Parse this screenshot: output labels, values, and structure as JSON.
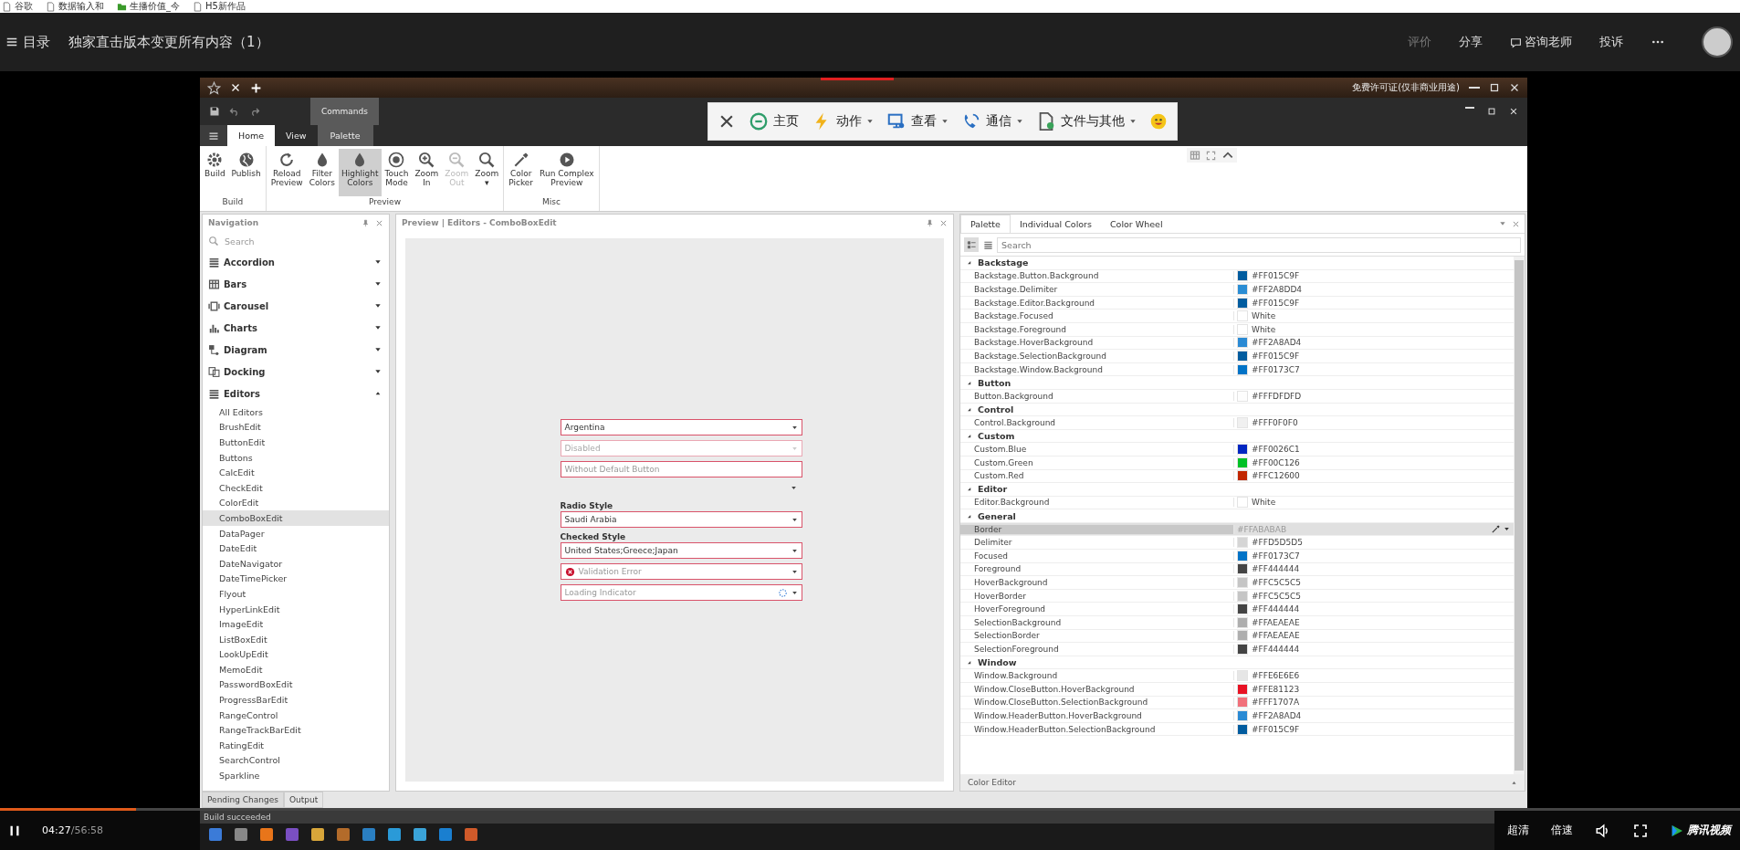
{
  "bookmarks": [
    {
      "label": "谷歌"
    },
    {
      "label": "数据输入和"
    },
    {
      "label": "生播价值_今"
    },
    {
      "label": "H5新作品"
    }
  ],
  "header": {
    "menu_label": "目录",
    "title": "独家直击版本变更所有内容（1）",
    "actions": [
      {
        "label": "评价",
        "disabled": true
      },
      {
        "label": "分享",
        "disabled": false
      },
      {
        "label": "咨询老师",
        "disabled": false
      },
      {
        "label": "投诉",
        "disabled": false
      }
    ]
  },
  "video": {
    "titlebar_text": "免费许可证(仅非商业用途)",
    "contextual_group": "Commands",
    "tabs": [
      {
        "label": "Home",
        "selected": true,
        "contextual": false
      },
      {
        "label": "View",
        "selected": false,
        "contextual": false
      },
      {
        "label": "Palette",
        "selected": false,
        "contextual": true
      }
    ],
    "overlay_toolbar": [
      {
        "kind": "close"
      },
      {
        "kind": "item",
        "label": "主页",
        "dropdown": false
      },
      {
        "kind": "item",
        "label": "动作",
        "dropdown": true
      },
      {
        "kind": "item",
        "label": "查看",
        "dropdown": true
      },
      {
        "kind": "item",
        "label": "通信",
        "dropdown": true
      },
      {
        "kind": "item",
        "label": "文件与其他",
        "dropdown": true
      },
      {
        "kind": "emoji"
      }
    ],
    "ribbon": [
      {
        "label": "Build",
        "buttons": [
          {
            "lines": [
              "Build"
            ],
            "pressed": false,
            "disabled": false
          },
          {
            "lines": [
              "Publish"
            ],
            "pressed": false,
            "disabled": false
          }
        ]
      },
      {
        "label": "Preview",
        "buttons": [
          {
            "lines": [
              "Reload",
              "Preview"
            ],
            "pressed": false,
            "disabled": false
          },
          {
            "lines": [
              "Filter",
              "Colors"
            ],
            "pressed": false,
            "disabled": false
          },
          {
            "lines": [
              "Highlight",
              "Colors"
            ],
            "pressed": true,
            "disabled": false
          },
          {
            "lines": [
              "Touch",
              "Mode"
            ],
            "pressed": false,
            "disabled": false
          },
          {
            "lines": [
              "Zoom",
              "In"
            ],
            "pressed": false,
            "disabled": false
          },
          {
            "lines": [
              "Zoom",
              "Out"
            ],
            "pressed": false,
            "disabled": true
          },
          {
            "lines": [
              "Zoom",
              "▾"
            ],
            "pressed": false,
            "disabled": false
          }
        ]
      },
      {
        "label": "Misc",
        "buttons": [
          {
            "lines": [
              "Color",
              "Picker"
            ],
            "pressed": false,
            "disabled": false
          },
          {
            "lines": [
              "Run Complex",
              "Preview"
            ],
            "pressed": false,
            "disabled": false
          }
        ]
      }
    ],
    "navigation": {
      "title": "Navigation",
      "search_placeholder": "Search",
      "groups": [
        {
          "label": "Accordion",
          "expanded": false
        },
        {
          "label": "Bars",
          "expanded": false
        },
        {
          "label": "Carousel",
          "expanded": false
        },
        {
          "label": "Charts",
          "expanded": false
        },
        {
          "label": "Diagram",
          "expanded": false
        },
        {
          "label": "Docking",
          "expanded": false
        },
        {
          "label": "Editors",
          "expanded": true,
          "children": [
            {
              "label": "All Editors",
              "selected": false
            },
            {
              "label": "BrushEdit",
              "selected": false
            },
            {
              "label": "ButtonEdit",
              "selected": false
            },
            {
              "label": "Buttons",
              "selected": false
            },
            {
              "label": "CalcEdit",
              "selected": false
            },
            {
              "label": "CheckEdit",
              "selected": false
            },
            {
              "label": "ColorEdit",
              "selected": false
            },
            {
              "label": "ComboBoxEdit",
              "selected": true
            },
            {
              "label": "DataPager",
              "selected": false
            },
            {
              "label": "DateEdit",
              "selected": false
            },
            {
              "label": "DateNavigator",
              "selected": false
            },
            {
              "label": "DateTimePicker",
              "selected": false
            },
            {
              "label": "Flyout",
              "selected": false
            },
            {
              "label": "HyperLinkEdit",
              "selected": false
            },
            {
              "label": "ImageEdit",
              "selected": false
            },
            {
              "label": "ListBoxEdit",
              "selected": false
            },
            {
              "label": "LookUpEdit",
              "selected": false
            },
            {
              "label": "MemoEdit",
              "selected": false
            },
            {
              "label": "PasswordBoxEdit",
              "selected": false
            },
            {
              "label": "ProgressBarEdit",
              "selected": false
            },
            {
              "label": "RangeControl",
              "selected": false
            },
            {
              "label": "RangeTrackBarEdit",
              "selected": false
            },
            {
              "label": "RatingEdit",
              "selected": false
            },
            {
              "label": "SearchControl",
              "selected": false
            },
            {
              "label": "Sparkline",
              "selected": false
            }
          ]
        }
      ]
    },
    "preview": {
      "title": "Preview | Editors - ComboBoxEdit",
      "fields": [
        {
          "kind": "combo",
          "text": "Argentina",
          "disabled": false
        },
        {
          "kind": "combo",
          "text": "Disabled",
          "disabled": true
        },
        {
          "kind": "text",
          "placeholder": "Without Default Button"
        },
        {
          "kind": "arrow"
        },
        {
          "kind": "label",
          "text": "Radio Style"
        },
        {
          "kind": "combo",
          "text": "Saudi Arabia",
          "disabled": false
        },
        {
          "kind": "label",
          "text": "Checked Style"
        },
        {
          "kind": "combo",
          "text": "United States;Greece;Japan",
          "disabled": false
        },
        {
          "kind": "error",
          "placeholder": "Validation Error"
        },
        {
          "kind": "loading",
          "placeholder": "Loading Indicator"
        }
      ]
    },
    "palette": {
      "tabs": [
        {
          "label": "Palette",
          "selected": true
        },
        {
          "label": "Individual Colors",
          "selected": false
        },
        {
          "label": "Color Wheel",
          "selected": false
        }
      ],
      "view_modes": [
        {
          "selected": true
        },
        {
          "selected": false
        }
      ],
      "search_placeholder": "Search",
      "footer": "Color Editor",
      "groups": [
        {
          "label": "Backstage",
          "expanded": true,
          "rows": [
            {
              "name": "Backstage.Button.Background",
              "value": "#FF015C9F",
              "color": "#015c9f",
              "selected": false
            },
            {
              "name": "Backstage.Delimiter",
              "value": "#FF2A8DD4",
              "color": "#2a8dd4",
              "selected": false
            },
            {
              "name": "Backstage.Editor.Background",
              "value": "#FF015C9F",
              "color": "#015c9f",
              "selected": false
            },
            {
              "name": "Backstage.Focused",
              "value": "White",
              "color": "#ffffff",
              "selected": false
            },
            {
              "name": "Backstage.Foreground",
              "value": "White",
              "color": "#ffffff",
              "selected": false
            },
            {
              "name": "Backstage.HoverBackground",
              "value": "#FF2A8AD4",
              "color": "#2a8ad4",
              "selected": false
            },
            {
              "name": "Backstage.SelectionBackground",
              "value": "#FF015C9F",
              "color": "#015c9f",
              "selected": false
            },
            {
              "name": "Backstage.Window.Background",
              "value": "#FF0173C7",
              "color": "#0173c7",
              "selected": false
            }
          ]
        },
        {
          "label": "Button",
          "expanded": true,
          "rows": [
            {
              "name": "Button.Background",
              "value": "#FFFDFDFD",
              "color": "#fdfdfd",
              "selected": false
            }
          ]
        },
        {
          "label": "Control",
          "expanded": true,
          "rows": [
            {
              "name": "Control.Background",
              "value": "#FFF0F0F0",
              "color": "#f0f0f0",
              "selected": false
            }
          ]
        },
        {
          "label": "Custom",
          "expanded": true,
          "rows": [
            {
              "name": "Custom.Blue",
              "value": "#FF0026C1",
              "color": "#0026c1",
              "selected": false
            },
            {
              "name": "Custom.Green",
              "value": "#FF00C126",
              "color": "#00c126",
              "selected": false
            },
            {
              "name": "Custom.Red",
              "value": "#FFC12600",
              "color": "#c12600",
              "selected": false
            }
          ]
        },
        {
          "label": "Editor",
          "expanded": true,
          "rows": [
            {
              "name": "Editor.Background",
              "value": "White",
              "color": "#ffffff",
              "selected": false
            }
          ]
        },
        {
          "label": "General",
          "expanded": true,
          "rows": [
            {
              "name": "Border",
              "value": "#FFABABAB",
              "selected": true
            },
            {
              "name": "Delimiter",
              "value": "#FFD5D5D5",
              "color": "#d5d5d5",
              "selected": false
            },
            {
              "name": "Focused",
              "value": "#FF0173C7",
              "color": "#0173c7",
              "selected": false
            },
            {
              "name": "Foreground",
              "value": "#FF444444",
              "color": "#444444",
              "selected": false
            },
            {
              "name": "HoverBackground",
              "value": "#FFC5C5C5",
              "color": "#c5c5c5",
              "selected": false
            },
            {
              "name": "HoverBorder",
              "value": "#FFC5C5C5",
              "color": "#c5c5c5",
              "selected": false
            },
            {
              "name": "HoverForeground",
              "value": "#FF444444",
              "color": "#444444",
              "selected": false
            },
            {
              "name": "SelectionBackground",
              "value": "#FFAEAEAE",
              "color": "#aeaeae",
              "selected": false
            },
            {
              "name": "SelectionBorder",
              "value": "#FFAEAEAE",
              "color": "#aeaeae",
              "selected": false
            },
            {
              "name": "SelectionForeground",
              "value": "#FF444444",
              "color": "#444444",
              "selected": false
            }
          ]
        },
        {
          "label": "Window",
          "expanded": true,
          "rows": [
            {
              "name": "Window.Background",
              "value": "#FFE6E6E6",
              "color": "#e6e6e6",
              "selected": false
            },
            {
              "name": "Window.CloseButton.HoverBackground",
              "value": "#FFE81123",
              "color": "#e81123",
              "selected": false
            },
            {
              "name": "Window.CloseButton.SelectionBackground",
              "value": "#FFF1707A",
              "color": "#f1707a",
              "selected": false
            },
            {
              "name": "Window.HeaderButton.HoverBackground",
              "value": "#FF2A8AD4",
              "color": "#2a8ad4",
              "selected": false
            },
            {
              "name": "Window.HeaderButton.SelectionBackground",
              "value": "#FF015C9F",
              "color": "#015c9f",
              "selected": false
            }
          ]
        }
      ]
    },
    "bottom_tabs": [
      {
        "label": "Pending Changes",
        "selected": true
      },
      {
        "label": "Output",
        "selected": false
      }
    ],
    "status": "Build succeeded"
  },
  "player": {
    "playing": true,
    "level": 0.078,
    "current": "04:27",
    "total": "/56:58",
    "quality": "超清",
    "speed": "倍速",
    "brand": "腾讯视频"
  }
}
